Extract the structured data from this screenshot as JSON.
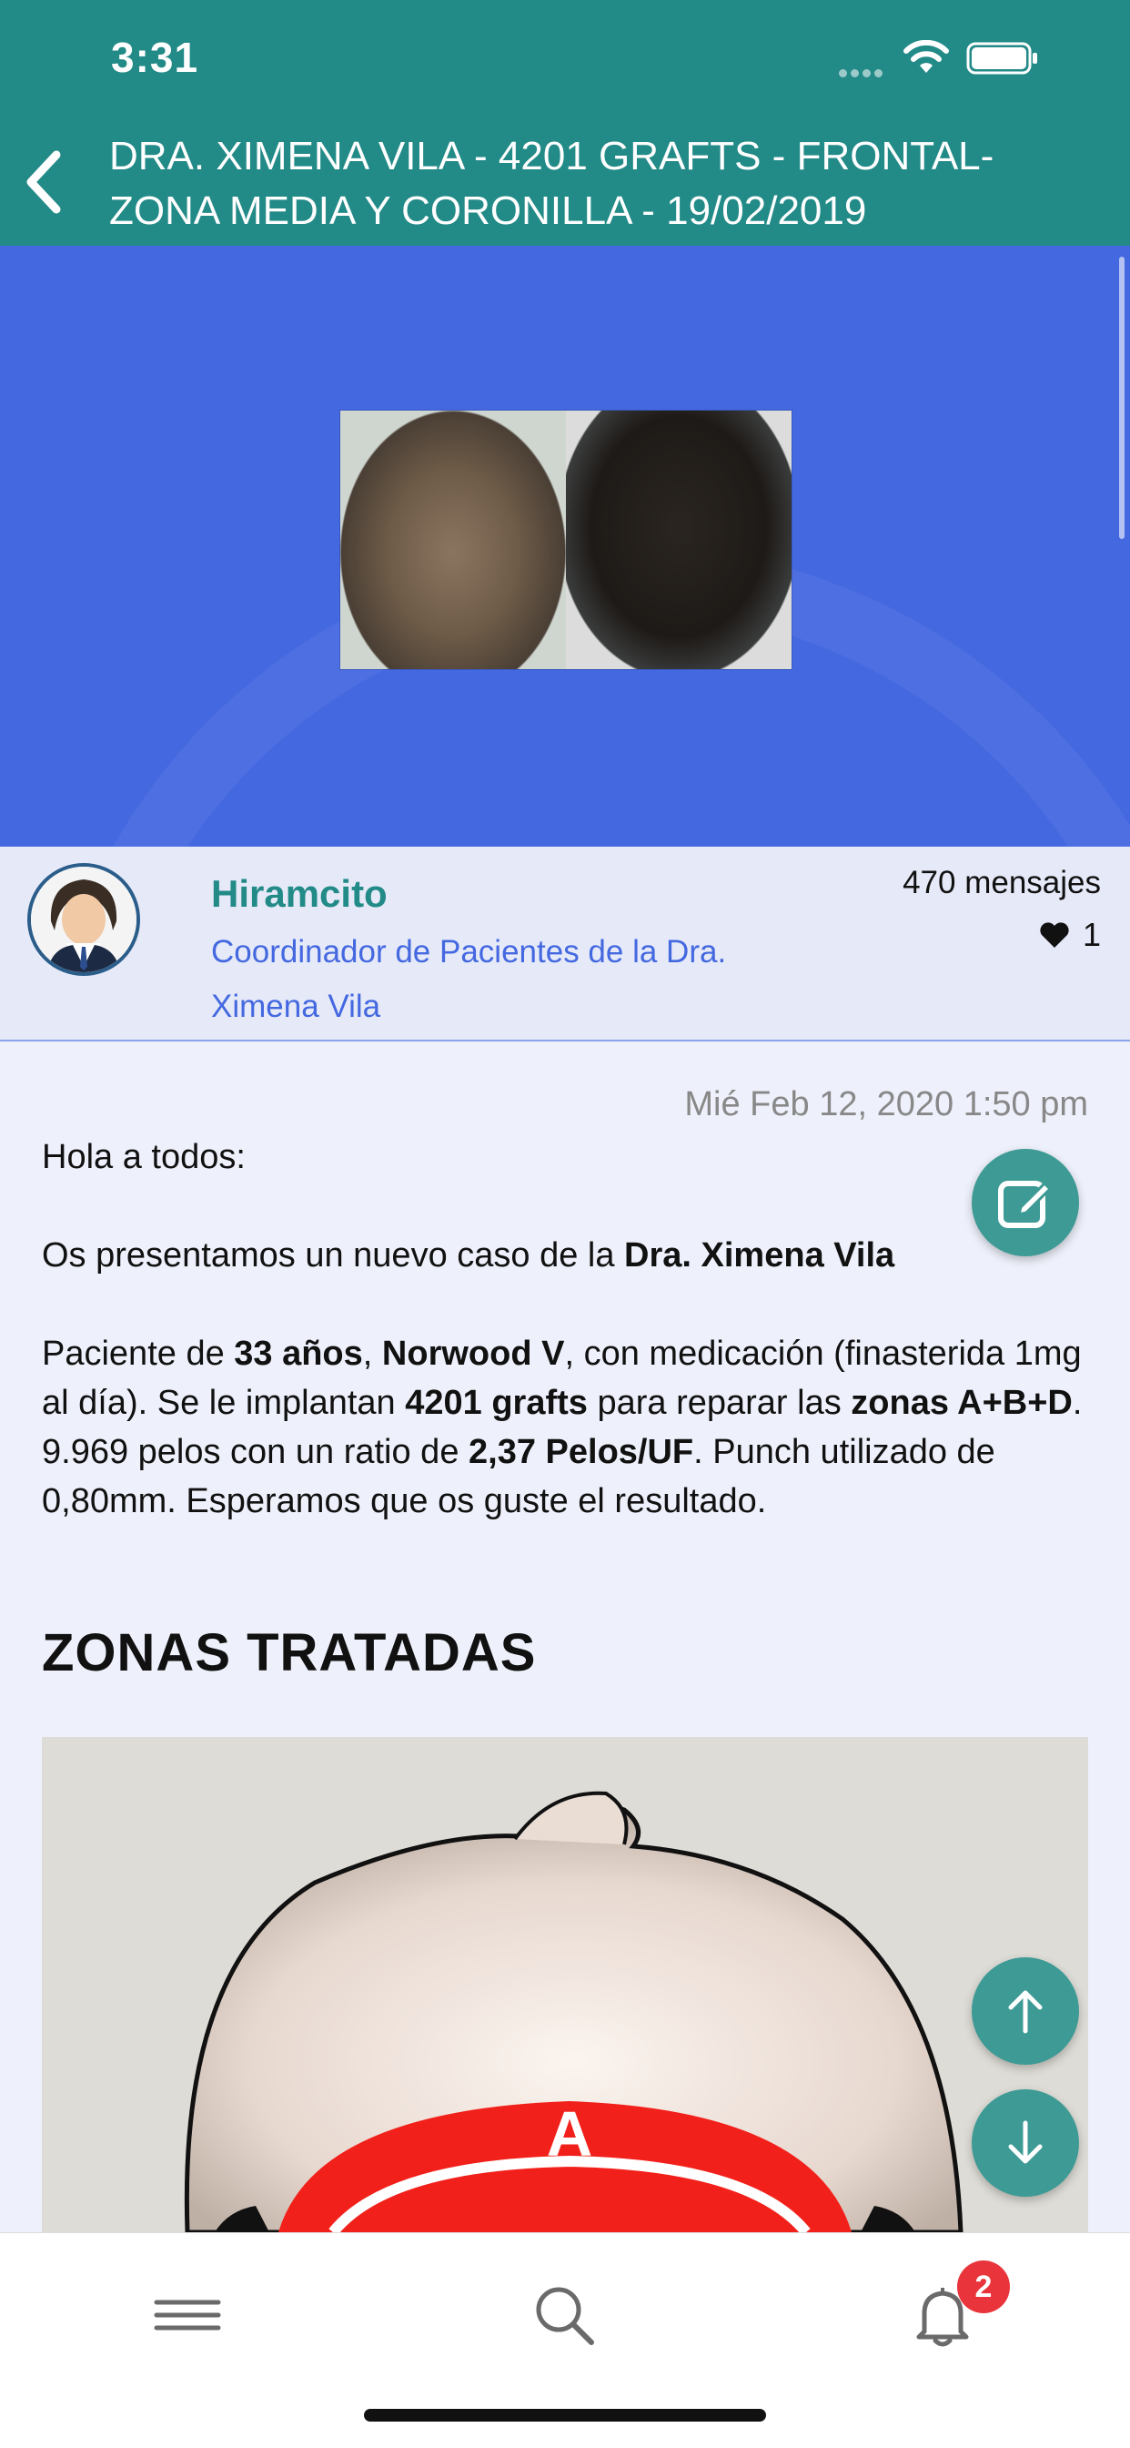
{
  "status": {
    "time": "3:31"
  },
  "header": {
    "title": "DRA. XIMENA VILA - 4201 GRAFTS - FRONTAL- ZONA MEDIA Y CORONILLA - 19/02/2019"
  },
  "author": {
    "name": "Hiramcito",
    "role": "Coordinador de Pacientes de la Dra. Ximena Vila",
    "messages": "470 mensajes",
    "likes": "1"
  },
  "post": {
    "date": "Mié Feb 12, 2020 1:50 pm",
    "greeting": "Hola a todos:",
    "intro_prefix": "Os presentamos un nuevo caso de la ",
    "intro_bold": "Dra. Ximena Vila",
    "p2_a": "Paciente de ",
    "p2_b": "33 años",
    "p2_c": ", ",
    "p2_d": "Norwood V",
    "p2_e": ", con medicación (finasterida 1mg al día). Se le implantan ",
    "p2_f": "4201 grafts",
    "p2_g": " para reparar las ",
    "p2_h": "zonas A+B+D",
    "p2_i": ". 9.969 pelos con un ratio de ",
    "p2_j": "2,37 Pelos/UF",
    "p2_k": ". Punch utilizado de 0,80mm. Esperamos que os guste el resultado.",
    "section_title": "ZONAS TRATADAS",
    "zone_label": "A"
  },
  "bottom_nav": {
    "notifications_badge": "2"
  },
  "icons": {
    "back": "chevron-left-icon",
    "edit": "edit-icon",
    "up": "arrow-up-icon",
    "down": "arrow-down-icon",
    "menu": "menu-icon",
    "search": "search-icon",
    "bell": "bell-icon",
    "heart": "heart-icon"
  },
  "colors": {
    "header_bg": "#228a87",
    "hero_bg": "#4468e0",
    "author_name": "#228a87",
    "author_role": "#4468e0",
    "fab": "#3d9a95",
    "badge": "#e8343a"
  }
}
